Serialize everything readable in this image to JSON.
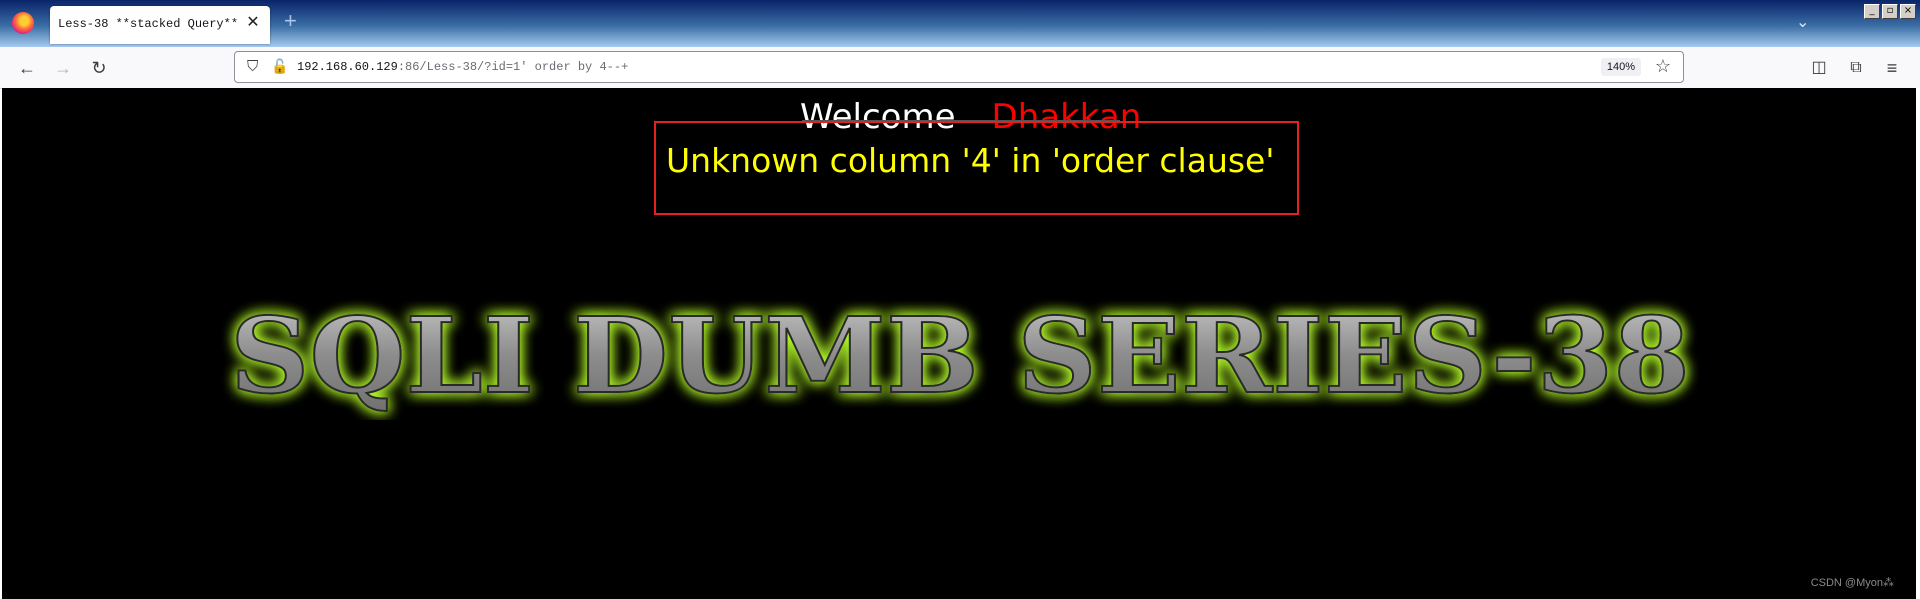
{
  "browser": {
    "tab": {
      "title": "Less-38 **stacked Query**"
    },
    "window_controls": [
      "_",
      "▫",
      "×"
    ],
    "url": {
      "host": "192.168.60.129",
      "rest": ":86/Less-38/?id=1' order by 4--+"
    },
    "zoom": "140%"
  },
  "page": {
    "welcome": "Welcome",
    "name": "Dhakkan",
    "error": "Unknown column '4' in 'order clause'",
    "banner": "SQLI DUMB SERIES-38",
    "watermark": "CSDN @Myon⁂"
  },
  "colors": {
    "error_text": "#ffff00",
    "name_text": "#ff0000",
    "box_border": "#e52020",
    "glow": "#b7ff2a"
  }
}
